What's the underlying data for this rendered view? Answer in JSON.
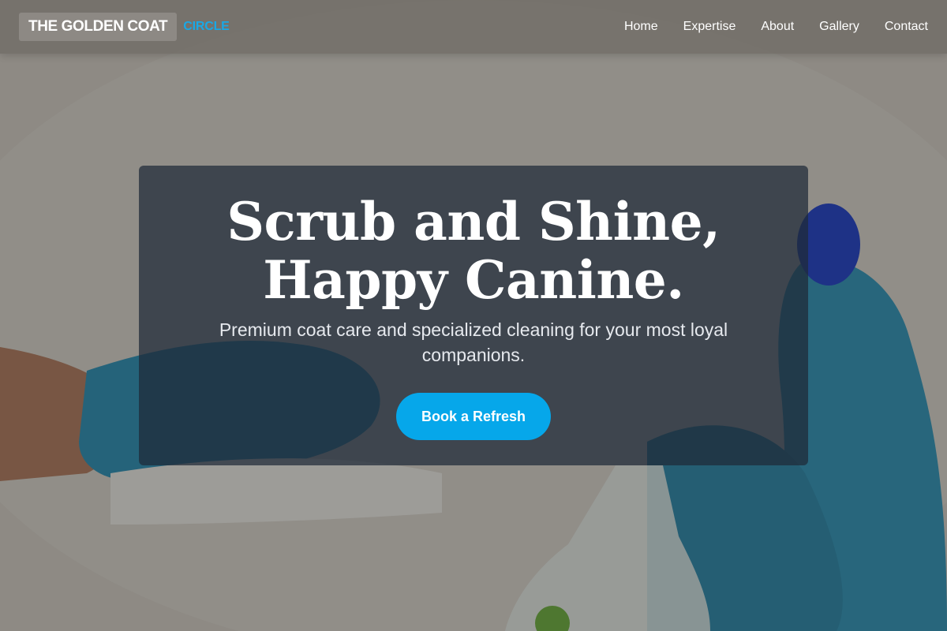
{
  "brand": {
    "name": "THE GOLDEN COAT",
    "accent": "CIRCLE"
  },
  "nav": {
    "items": [
      {
        "label": "Home"
      },
      {
        "label": "Expertise"
      },
      {
        "label": "About"
      },
      {
        "label": "Gallery"
      },
      {
        "label": "Contact"
      }
    ]
  },
  "hero": {
    "title_line1": "Scrub and Shine,",
    "title_line2": "Happy Canine.",
    "subtitle": "Premium coat care and specialized cleaning for your most loyal companions.",
    "cta_label": "Book a Refresh",
    "background_image": "gloved-hands-cleaning-photo"
  },
  "colors": {
    "accent": "#06a7ea",
    "brand_accent": "#19a8e6",
    "card_bg": "#1e2938",
    "text": "#ffffff"
  }
}
